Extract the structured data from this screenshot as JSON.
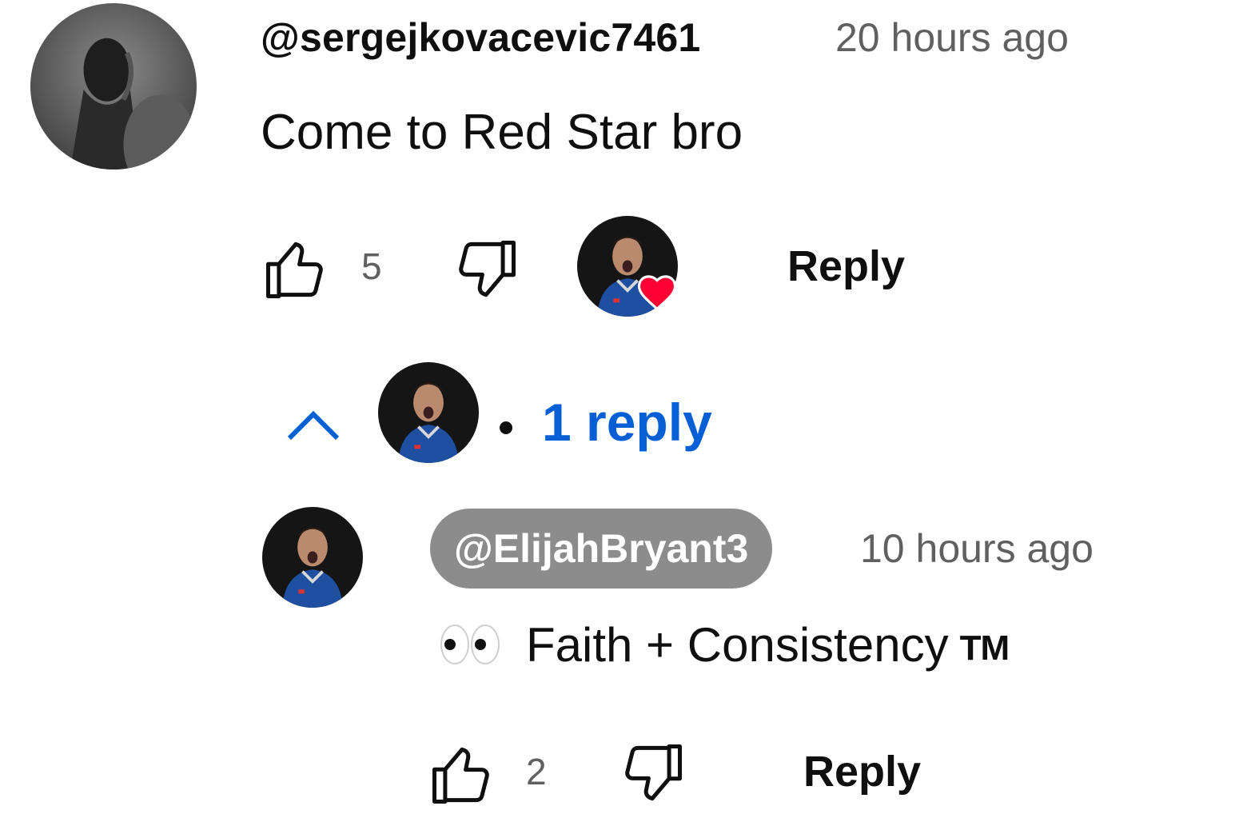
{
  "comment": {
    "author": "@sergejkovacevic7461",
    "time": "20 hours ago",
    "text": "Come to Red Star bro",
    "likes": "5",
    "reply_label": "Reply",
    "replies_toggle": "1 reply"
  },
  "reply": {
    "author": "@ElijahBryant3",
    "time": "10 hours ago",
    "emoji": "👀",
    "text": "Faith + Consistency",
    "trademark": "TM",
    "likes": "2",
    "reply_label": "Reply"
  },
  "colors": {
    "link_blue": "#065fd4",
    "heart_red": "#ff0033",
    "chip_gray": "#8c8c8c",
    "meta_gray": "#606060"
  },
  "icons": {
    "like": "thumb-up-icon",
    "dislike": "thumb-down-icon",
    "heart": "heart-icon",
    "collapse": "chevron-up-icon"
  }
}
